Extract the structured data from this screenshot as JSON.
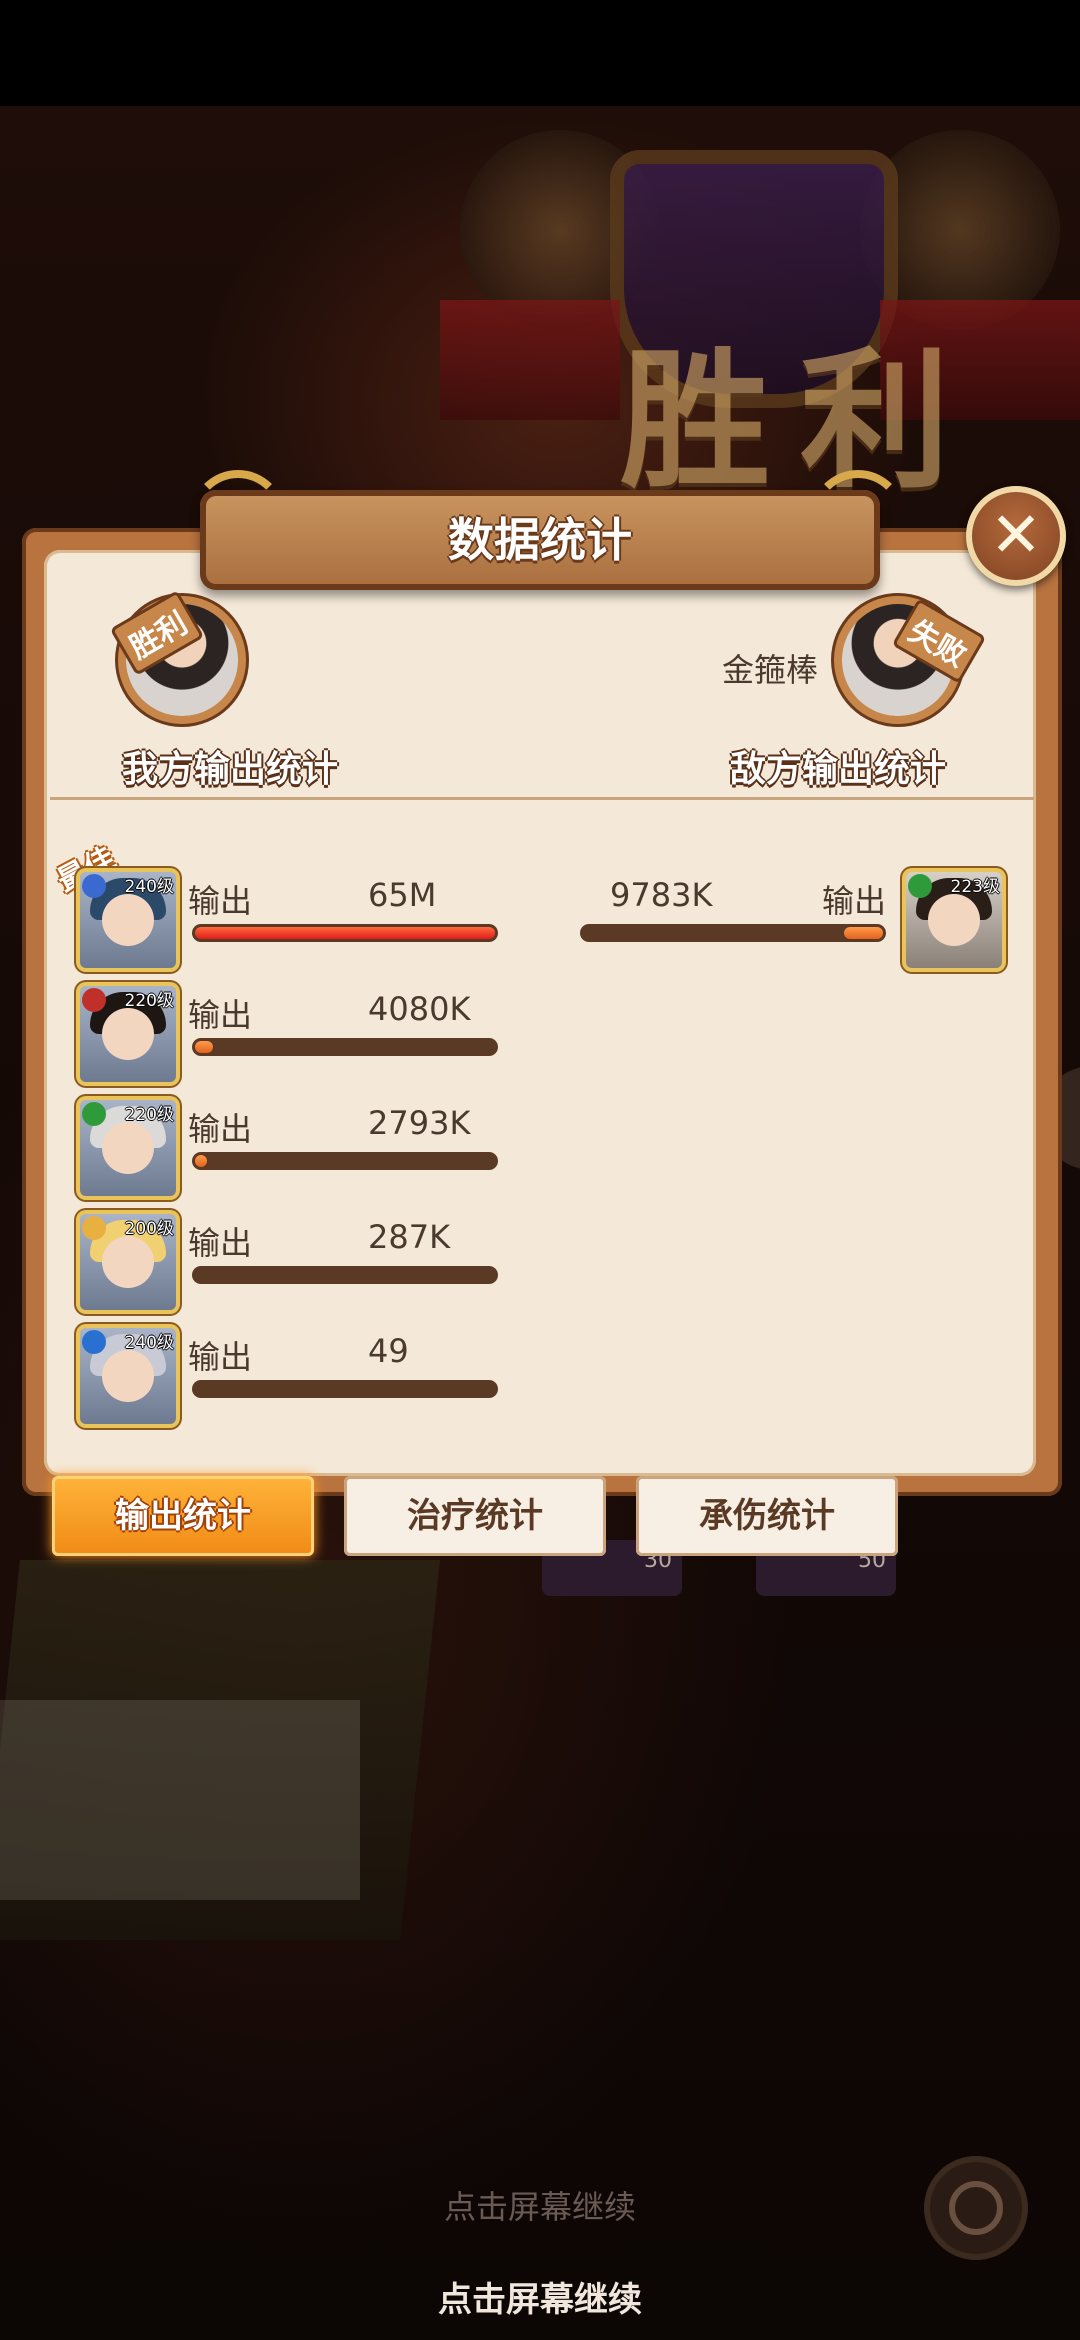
{
  "background": {
    "victory_text": "胜利",
    "items": [
      {
        "count": "30"
      },
      {
        "count": "50"
      }
    ]
  },
  "dialog": {
    "title": "数据统计",
    "close_label": "✕"
  },
  "our_side": {
    "stamp": "胜利",
    "title": "我方输出统计"
  },
  "enemy_side": {
    "stamp": "失败",
    "name": "金箍棒",
    "title": "敌方输出统计"
  },
  "best_tag": "最佳",
  "our_heroes": [
    {
      "level": "240级",
      "label": "输出",
      "value": "65M",
      "fraction": 1.0,
      "highlight": true,
      "hair": "#2b4a6a",
      "badge": "#3a6ad0"
    },
    {
      "level": "220级",
      "label": "输出",
      "value": "4080K",
      "fraction": 0.06,
      "highlight": false,
      "hair": "#1e1612",
      "badge": "#c0302a"
    },
    {
      "level": "220级",
      "label": "输出",
      "value": "2793K",
      "fraction": 0.04,
      "highlight": false,
      "hair": "#dcdad8",
      "badge": "#2f9a3a"
    },
    {
      "level": "200级",
      "label": "输出",
      "value": "287K",
      "fraction": 0.0,
      "highlight": false,
      "hair": "#f0d070",
      "badge": "#e8b040"
    },
    {
      "level": "240级",
      "label": "输出",
      "value": "49",
      "fraction": 0.0,
      "highlight": false,
      "hair": "#c8cbd6",
      "badge": "#2a70d0"
    }
  ],
  "enemy_heroes": [
    {
      "level": "223级",
      "label": "输出",
      "value": "9783K",
      "fraction": 0.13,
      "hair": "#2a1e18",
      "badge": "#2f9a3a"
    }
  ],
  "tabs": [
    {
      "label": "输出统计",
      "active": true
    },
    {
      "label": "治疗统计",
      "active": false
    },
    {
      "label": "承伤统计",
      "active": false
    }
  ],
  "continue_hint_faded": "点击屏幕继续",
  "continue_hint": "点击屏幕继续"
}
